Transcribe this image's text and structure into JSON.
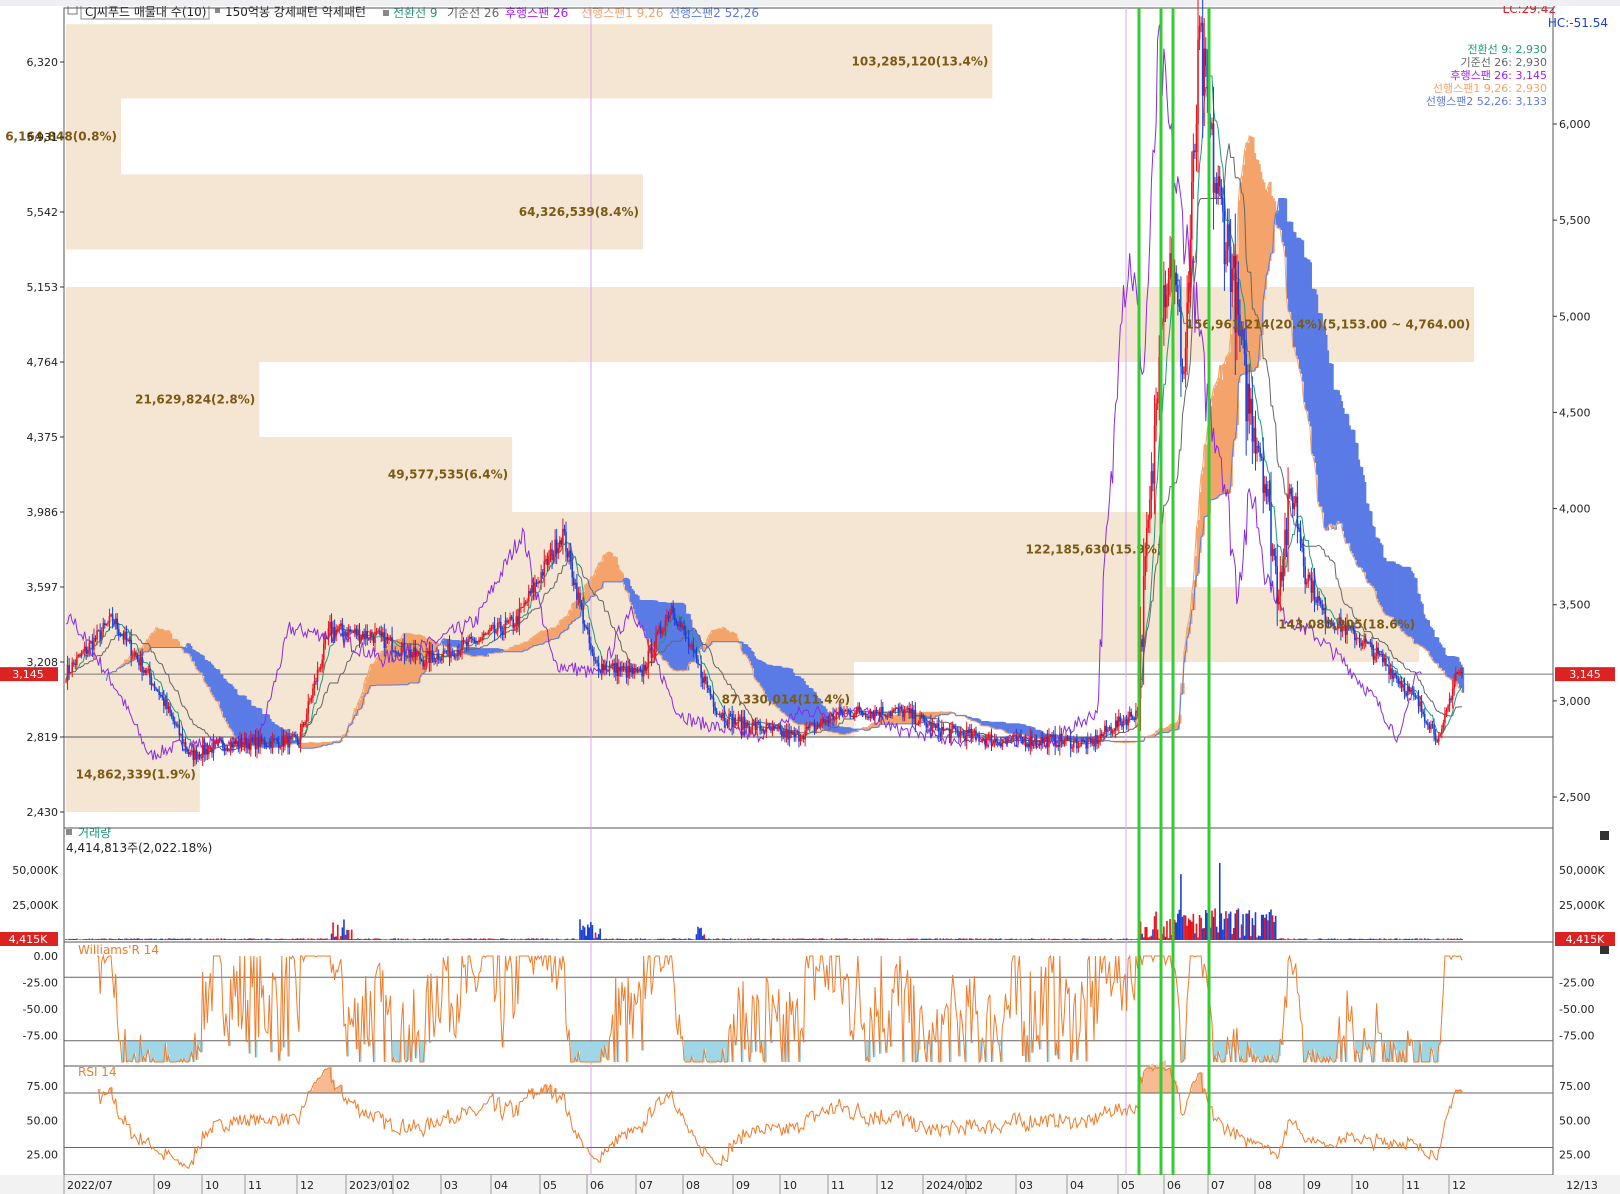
{
  "colors": {
    "background": "#ffffff",
    "axis_text": "#222222",
    "grid_frame": "#555555",
    "up_candle": "#e8141b",
    "down_candle": "#1a3fd6",
    "conversion_line": "#1f9a7a",
    "base_line": "#666666",
    "lagging_span": "#8a2be2",
    "leading_span1": "#f4a46a",
    "leading_span2": "#5b7be6",
    "volume_profile": "#f5e6d3",
    "volume_profile_text": "#7a5a14",
    "marker_line": "#33cc33",
    "event_line": "#d9a3f2",
    "price_badge": "#dd2222",
    "williams_line": "#f07b2a",
    "williams_fill": "#9fd7e6",
    "rsi_line": "#f07b2a",
    "rsi_fill": "#f7bb93"
  },
  "header": {
    "title": "CJ씨푸드 매물대 수(10)",
    "pattern_label": "150억봉 강세패턴  약세패턴",
    "legend": [
      {
        "label": "전환선 9",
        "color": "#1f9a7a"
      },
      {
        "label": "기준선 26",
        "color": "#666666"
      },
      {
        "label": "후행스팬 26",
        "color": "#a020f0"
      },
      {
        "label": "선행스팬1 9,26",
        "color": "#f4a46a"
      },
      {
        "label": "선행스팬2 52,26",
        "color": "#5b7be6"
      }
    ],
    "lc": "LC:29.42",
    "hc": "HC:-51.54"
  },
  "price_panel": {
    "left_ticks": [
      "6,320",
      "5,931",
      "5,542",
      "5,153",
      "4,764",
      "4,375",
      "3,986",
      "3,597",
      "3,208",
      "2,819",
      "2,430"
    ],
    "right_ticks": [
      "6,000",
      "5,500",
      "5,000",
      "4,500",
      "4,000",
      "3,500",
      "3,000",
      "2,500"
    ],
    "current_price": "3,145",
    "ichimoku_values": [
      {
        "label": "전환선 9: 2,930",
        "color": "#1f9a7a"
      },
      {
        "label": "기준선 26: 2,930",
        "color": "#666666"
      },
      {
        "label": "후행스팬 26: 3,145",
        "color": "#a020f0"
      },
      {
        "label": "선행스팬1 9,26: 2,930",
        "color": "#f4a46a"
      },
      {
        "label": "선행스팬2 52,26: 3,133",
        "color": "#5b7be6"
      }
    ],
    "volume_profile": [
      {
        "low": 6131,
        "high": 6516,
        "ratio": 0.623,
        "label": "103,285,120(13.4%)"
      },
      {
        "low": 5737,
        "high": 6131,
        "ratio": 0.037,
        "label": "6,164,848(0.8%)"
      },
      {
        "low": 5348,
        "high": 5737,
        "ratio": 0.388,
        "label": "64,326,539(8.4%)"
      },
      {
        "low": 4764,
        "high": 5153,
        "ratio": 0.947,
        "label": "156,961,214(20.4%)(5,153.00 ~ 4,764.00)"
      },
      {
        "low": 4375,
        "high": 4764,
        "ratio": 0.13,
        "label": "21,629,824(2.8%)"
      },
      {
        "low": 3986,
        "high": 4375,
        "ratio": 0.3,
        "label": "49,577,535(6.4%)"
      },
      {
        "low": 3597,
        "high": 3986,
        "ratio": 0.74,
        "label": "122,185,630(15.9%)"
      },
      {
        "low": 3208,
        "high": 3597,
        "ratio": 0.91,
        "label": "143,080,205(18.6%)"
      },
      {
        "low": 2819,
        "high": 3208,
        "ratio": 0.53,
        "label": "87,330,014(11.4%)"
      },
      {
        "low": 2430,
        "high": 2819,
        "ratio": 0.09,
        "label": "14,862,339(1.9%)"
      }
    ]
  },
  "volume_panel": {
    "title": "거래량",
    "subtitle": "4,414,813주(2,022.18%)",
    "ticks": [
      "50,000K",
      "25,000K"
    ],
    "current": "4,415K"
  },
  "williams_panel": {
    "title": "Williams'R 14",
    "ticks": [
      "0.00",
      "-25.00",
      "-50.00",
      "-75.00"
    ],
    "right_ticks": [
      "-25.00",
      "-50.00",
      "-75.00"
    ]
  },
  "rsi_panel": {
    "title": "RSI 14",
    "ticks": [
      "75.00",
      "50.00",
      "25.00"
    ]
  },
  "x_axis": {
    "labels": [
      "2022/07",
      "09",
      "10",
      "11",
      "12",
      "2023/01",
      "02",
      "03",
      "04",
      "05",
      "06",
      "07",
      "08",
      "09",
      "10",
      "11",
      "12",
      "2024/01",
      "02",
      "03",
      "04",
      "05",
      "06",
      "07",
      "08",
      "09",
      "10",
      "11",
      "12"
    ],
    "date_label": "12/13"
  },
  "controls": {
    "collapse_icon": "square-icon"
  }
}
